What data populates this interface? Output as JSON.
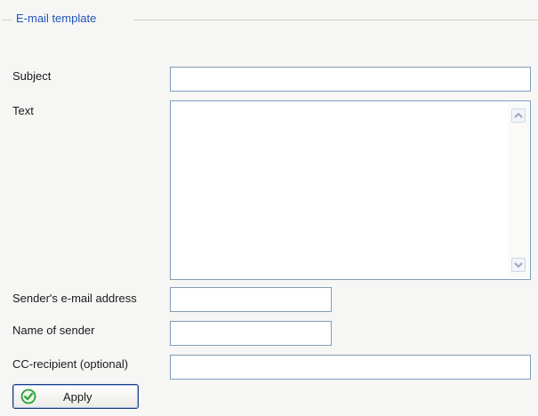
{
  "group": {
    "title": "E-mail template"
  },
  "form": {
    "subject_label": "Subject",
    "subject_value": "",
    "text_label": "Text",
    "text_value": "",
    "sender_email_label": "Sender's e-mail address",
    "sender_email_value": "",
    "sender_name_label": "Name of sender",
    "sender_name_value": "",
    "cc_label": "CC-recipient (optional)",
    "cc_value": ""
  },
  "apply_button": {
    "label": "Apply",
    "icon": "check-circle-icon"
  },
  "colors": {
    "group_title": "#2255bb",
    "field_border": "#7f9db9",
    "button_border": "#1b3b86",
    "check_icon": "#2aa03a"
  }
}
